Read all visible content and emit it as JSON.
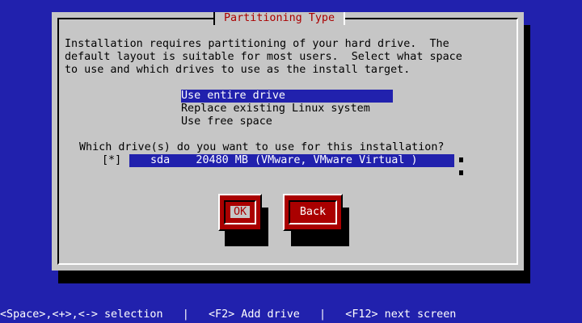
{
  "dialog": {
    "title": "Partitioning Type",
    "intro_lines": [
      "Installation requires partitioning of your hard drive.  The",
      "default layout is suitable for most users.  Select what space",
      "to use and which drives to use as the install target."
    ],
    "options": [
      {
        "label": "Use entire drive",
        "selected": true
      },
      {
        "label": "Replace existing Linux system",
        "selected": false
      },
      {
        "label": "Use free space",
        "selected": false
      }
    ],
    "drive_question": "Which drive(s) do you want to use for this installation?",
    "drives": [
      {
        "checkbox": "[*]",
        "label": "sda    20480 MB (VMware, VMware Virtual )"
      }
    ],
    "buttons": {
      "ok": "OK",
      "back": "Back"
    }
  },
  "statusbar": {
    "text": "<Space>,<+>,<-> selection   |   <F2> Add drive   |   <F12> next screen"
  },
  "colors": {
    "background": "#2121ad",
    "dialog": "#c6c6c6",
    "title": "#aa0000",
    "button": "#aa0000",
    "selection": "#2121ad"
  }
}
